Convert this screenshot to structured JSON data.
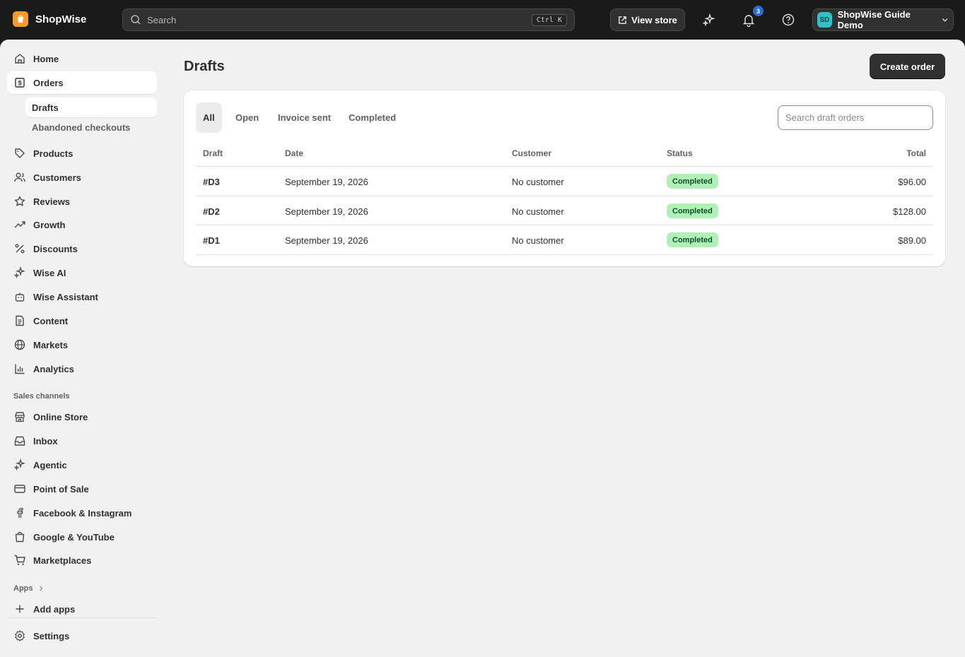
{
  "app": {
    "name": "ShopWise"
  },
  "search": {
    "placeholder": "Search",
    "shortcut": "Ctrl K"
  },
  "topbar": {
    "view_store_label": "View store",
    "notification_count": "3",
    "account_initials": "SD",
    "account_name": "ShopWise Guide Demo"
  },
  "sidebar": {
    "items": [
      {
        "label": "Home",
        "icon": "home-icon"
      },
      {
        "label": "Orders",
        "icon": "orders-icon"
      },
      {
        "label": "Products",
        "icon": "tag-icon"
      },
      {
        "label": "Customers",
        "icon": "customers-icon"
      },
      {
        "label": "Reviews",
        "icon": "star-icon"
      },
      {
        "label": "Growth",
        "icon": "trend-up-icon"
      },
      {
        "label": "Discounts",
        "icon": "percent-icon"
      },
      {
        "label": "Wise AI",
        "icon": "sparkle-icon"
      },
      {
        "label": "Wise Assistant",
        "icon": "robot-icon"
      },
      {
        "label": "Content",
        "icon": "document-icon"
      },
      {
        "label": "Markets",
        "icon": "globe-icon"
      },
      {
        "label": "Analytics",
        "icon": "bar-chart-icon"
      }
    ],
    "orders_sub": [
      {
        "label": "Drafts"
      },
      {
        "label": "Abandoned checkouts"
      }
    ],
    "sales_channels_label": "Sales channels",
    "channels": [
      {
        "label": "Online Store",
        "icon": "store-icon"
      },
      {
        "label": "Inbox",
        "icon": "inbox-icon"
      },
      {
        "label": "Agentic",
        "icon": "sparkle-icon"
      },
      {
        "label": "Point of Sale",
        "icon": "card-icon"
      },
      {
        "label": "Facebook & Instagram",
        "icon": "facebook-icon"
      },
      {
        "label": "Google & YouTube",
        "icon": "bag-icon"
      },
      {
        "label": "Marketplaces",
        "icon": "cart-icon"
      }
    ],
    "apps_label": "Apps",
    "add_apps_label": "Add apps",
    "settings_label": "Settings"
  },
  "main": {
    "title": "Drafts",
    "create_button": "Create order",
    "tabs": [
      "All",
      "Open",
      "Invoice sent",
      "Completed"
    ],
    "search_placeholder": "Search draft orders",
    "columns": [
      "Draft",
      "Date",
      "Customer",
      "Status",
      "Total"
    ],
    "rows": [
      {
        "id": "#D3",
        "date": "September 19, 2026",
        "customer": "No customer",
        "status": "Completed",
        "total": "$96.00"
      },
      {
        "id": "#D2",
        "date": "September 19, 2026",
        "customer": "No customer",
        "status": "Completed",
        "total": "$128.00"
      },
      {
        "id": "#D1",
        "date": "September 19, 2026",
        "customer": "No customer",
        "status": "Completed",
        "total": "$89.00"
      }
    ]
  },
  "colors": {
    "topbar": "#1a1a1a",
    "accent_logo": "#f49b2a",
    "badge_blue": "#2c6ecb",
    "status_success_bg": "#aff0b5",
    "status_success_text": "#0c5132"
  }
}
